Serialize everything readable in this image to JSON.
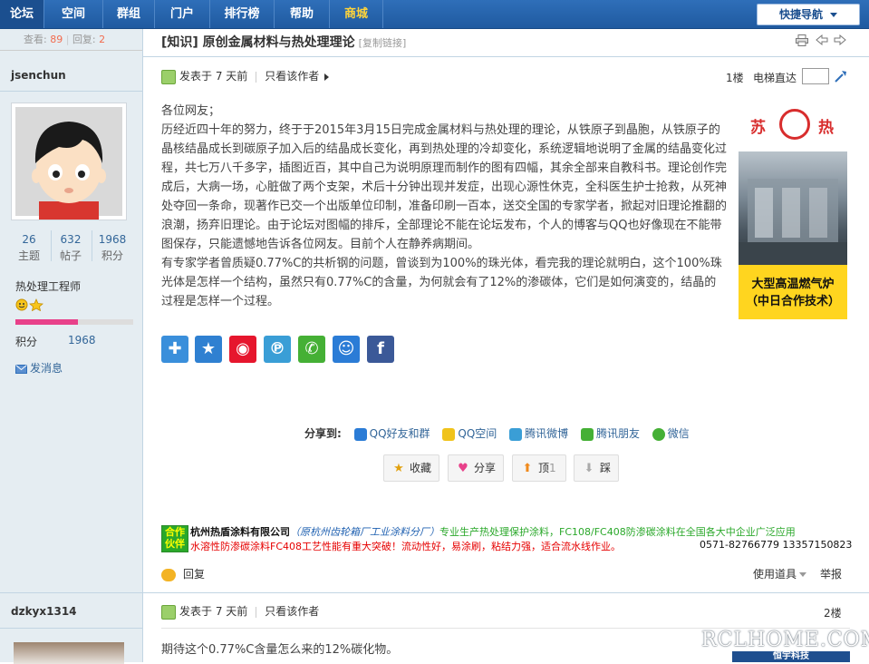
{
  "nav": {
    "items": [
      {
        "label": "论坛"
      },
      {
        "label": "空间"
      },
      {
        "label": "群组"
      },
      {
        "label": "门户"
      },
      {
        "label": "排行榜"
      },
      {
        "label": "帮助"
      },
      {
        "label": "商城"
      }
    ],
    "quick_nav": "快捷导航"
  },
  "thread": {
    "views_label": "查看:",
    "views": "89",
    "replies_label": "回复:",
    "replies": "2",
    "title": "[知识] 原创金属材料与热处理理论",
    "copy_link": "[复制链接]"
  },
  "post1": {
    "author": "jsenchun",
    "posted": "发表于 7 天前",
    "only_author": "只看该作者",
    "floor": "1楼",
    "elevator": "电梯直达",
    "stats": [
      {
        "value": "26",
        "label": "主题"
      },
      {
        "value": "632",
        "label": "帖子"
      },
      {
        "value": "1968",
        "label": "积分"
      }
    ],
    "group": "热处理工程师",
    "level_fraction": 0.53,
    "score_label": "积分",
    "score": "1968",
    "send_message": "发消息",
    "body": [
      "各位网友；",
      "历经近四十年的努力，终于于2015年3月15日完成金属材料与热处理的理论，从铁原子到晶胞，从铁原子的晶核结晶成长到碳原子加入后的结晶成长变化，再到热处理的冷却变化，系统逻辑地说明了金属的结晶变化过程，共七万八千多字，插图近百，其中自己为说明原理而制作的图有四幅，其余全部来自教科书。理论创作完成后，大病一场，心脏做了两个支架，术后十分钟出现并发症，出现心源性休克，全科医生护士抢救，从死神处夺回一条命，现著作已交一个出版单位印制，准备印刷一百本，送交全国的专家学者，掀起对旧理论推翻的浪潮，扬弃旧理论。由于论坛对图幅的排斥，全部理论不能在论坛发布，个人的博客与QQ也好像现在不能带图保存，只能遗憾地告诉各位网友。目前个人在静养病期间。",
      "有专家学者曾质疑0.77%C的共析钢的问题，曾谈到为100%的珠光体，看完我的理论就明白，这个100%珠光体是怎样一个结构，虽然只有0.77%C的含量，为何就会有了12%的渗碳体，它们是如何演变的，结晶的过程是怎样一个过程。"
    ],
    "ad": {
      "left_char": "苏",
      "right_char": "热",
      "line1": "大型高温燃气炉",
      "line2": "（中日合作技术）"
    },
    "share_to_label": "分享到:",
    "share_targets": [
      "QQ好友和群",
      "QQ空间",
      "腾讯微博",
      "腾讯朋友",
      "微信"
    ],
    "actions": [
      {
        "label": "收藏"
      },
      {
        "label": "分享"
      },
      {
        "label": "顶",
        "count": "1"
      },
      {
        "label": "踩"
      }
    ],
    "partner": {
      "badge_line1": "合作",
      "badge_line2": "伙伴",
      "company": "杭州热盾涂料有限公司",
      "company_former": "（原杭州齿轮箱厂工业涂料分厂）",
      "slogan": "专业生产热处理保护涂料，FC108/FC408防渗碳涂料在全国各大中企业广泛应用",
      "line2": "水溶性防渗碳涂料FC408工艺性能有重大突破！流动性好，易涂刷，粘结力强，适合流水线作业。",
      "phones": "0571-82766779 13357150823"
    },
    "reply": "回复",
    "tools": "使用道具",
    "report": "举报"
  },
  "post2": {
    "author": "dzkyx1314",
    "posted": "发表于 7 天前",
    "only_author": "只看该作者",
    "floor": "2楼",
    "body": "期待这个0.77%C含量怎么来的12%碳化物。"
  },
  "watermark": {
    "text": "RCLHOME.COM",
    "sub": "恒宇科技"
  },
  "colors": {
    "nav_bg": "#2f6fb9",
    "mall": "#ffd43a",
    "link": "#336699",
    "accent_red": "#f26c4f",
    "level_bar": "#e8418a"
  }
}
